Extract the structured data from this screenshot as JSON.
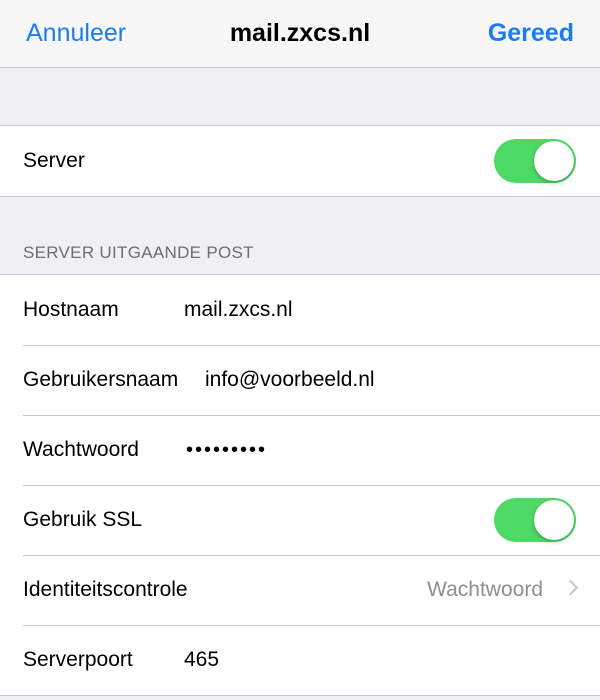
{
  "navbar": {
    "cancel_label": "Annuleer",
    "title": "mail.zxcs.nl",
    "done_label": "Gereed"
  },
  "colors": {
    "accent": "#1a7cf5",
    "toggle_on": "#4cd964",
    "background": "#efeff4"
  },
  "server_group": {
    "label": "Server",
    "toggle_on": true
  },
  "outgoing": {
    "section_header": "SERVER UITGAANDE POST",
    "hostname_label": "Hostnaam",
    "hostname_value": "mail.zxcs.nl",
    "username_label": "Gebruikersnaam",
    "username_value": "info@voorbeeld.nl",
    "password_label": "Wachtwoord",
    "password_value": "•••••••••",
    "ssl_label": "Gebruik SSL",
    "ssl_on": true,
    "auth_label": "Identiteitscontrole",
    "auth_value": "Wachtwoord",
    "port_label": "Serverpoort",
    "port_value": "465"
  }
}
